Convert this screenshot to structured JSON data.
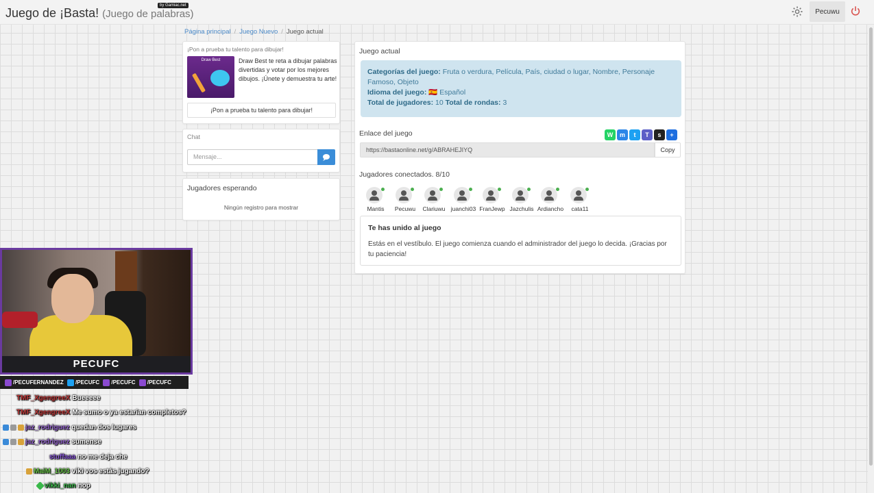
{
  "header": {
    "title": "Juego de ¡Basta!",
    "subtitle": "(Juego de palabras)",
    "badge": "by Gamiac.net",
    "user": "Pecuwu"
  },
  "breadcrumb": [
    "Página principal",
    "Juego Nuevo",
    "Juego actual"
  ],
  "promo": {
    "title": "¡Pon a prueba tu talento para dibujar!",
    "image_label": "Draw Best",
    "text": "Draw Best te reta a dibujar palabras divertidas y votar por los mejores dibujos. ¡Únete y demuestra tu arte!",
    "button": "¡Pon a prueba tu talento para dibujar!"
  },
  "chat": {
    "title": "Chat",
    "placeholder": "Mensaje..."
  },
  "waiting": {
    "title": "Jugadores esperando",
    "empty": "Ningún registro para mostrar"
  },
  "game": {
    "title": "Juego actual",
    "categories_label": "Categorías del juego:",
    "categories_value": "Fruta o verdura, Película, País, ciudad o lugar, Nombre, Personaje Famoso, Objeto",
    "language_label": "Idioma del juego:",
    "language_value": "Español",
    "players_label": "Total de jugadores:",
    "players_value": "10",
    "rounds_label": "Total de rondas:",
    "rounds_value": "3",
    "link_title": "Enlace del juego",
    "link_url": "https://bastaonline.net/g/ABRAHEJIYQ",
    "copy": "Copy",
    "share_icons": [
      "whatsapp-icon",
      "messenger-icon",
      "twitter-icon",
      "teams-icon",
      "snapchat-icon",
      "add-icon"
    ],
    "connected_title": "Jugadores conectados. 8/10",
    "players": [
      "Mantis",
      "Pecuwu",
      "Clariuwu",
      "juanchi03",
      "FranJewp",
      "Jazchulis",
      "Ardiancho",
      "cata11"
    ],
    "joined_title": "Te has unido al juego",
    "joined_text": "Estás en el vestíbulo. El juego comienza cuando el administrador del juego lo decida. ¡Gracias por tu paciencia!"
  },
  "stream": {
    "cam_label": "PECUFC",
    "socials": [
      "/PECUFERNANDEZ",
      "/PECUFC",
      "/PECUFC",
      "/PECUFC"
    ],
    "chat": [
      {
        "user": "TMF_XgengreeX",
        "msg": "Bueeeee",
        "color": "#c03a3a"
      },
      {
        "user": "TMF_XgengreeX",
        "msg": "Me sumo o ya estarían completos?",
        "color": "#c03a3a"
      },
      {
        "user": "jaz_rodriguez",
        "msg": "quedan dos lugares",
        "color": "#9a6ad4"
      },
      {
        "user": "jaz_rodriguez",
        "msg": "sumense",
        "color": "#9a6ad4"
      },
      {
        "user": "stuffaaa",
        "msg": "no me deja che",
        "color": "#8a5ad8"
      },
      {
        "user": "MaiM_1003",
        "msg": "viki vos estás jugando?",
        "color": "#6ac44a"
      },
      {
        "user": "vikki_nan",
        "msg": "nop",
        "color": "#3ab84a"
      }
    ]
  },
  "colors": {
    "accent": "#3a8dd8",
    "info_bg": "#cfe4ef",
    "online": "#4caf50",
    "power": "#d9534f"
  }
}
